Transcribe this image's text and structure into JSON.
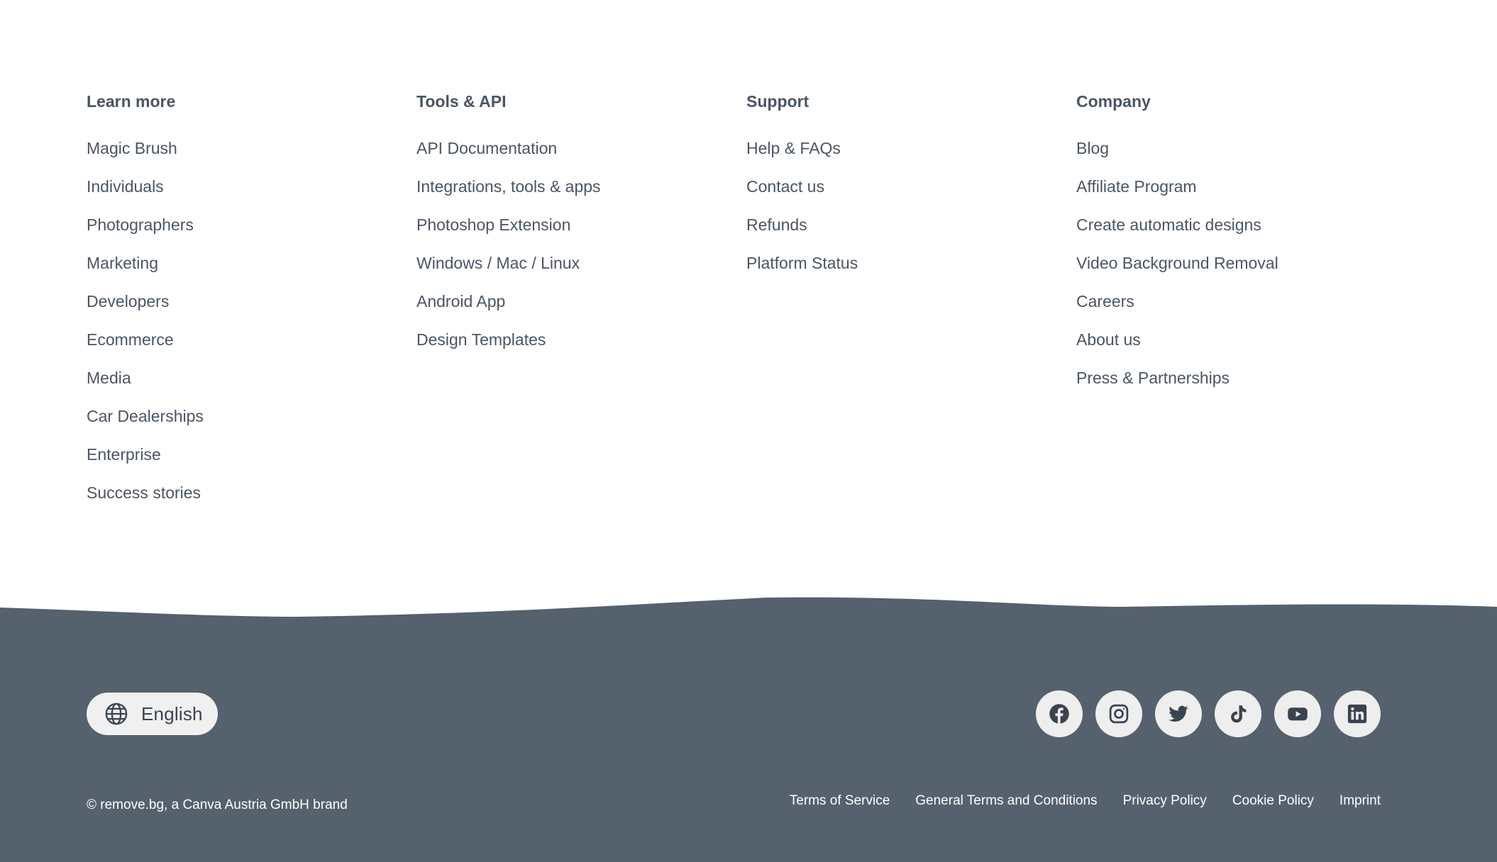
{
  "columns": [
    {
      "title": "Learn more",
      "links": [
        "Magic Brush",
        "Individuals",
        "Photographers",
        "Marketing",
        "Developers",
        "Ecommerce",
        "Media",
        "Car Dealerships",
        "Enterprise",
        "Success stories"
      ]
    },
    {
      "title": "Tools & API",
      "links": [
        "API Documentation",
        "Integrations, tools & apps",
        "Photoshop Extension",
        "Windows / Mac / Linux",
        "Android App",
        "Design Templates"
      ]
    },
    {
      "title": "Support",
      "links": [
        "Help & FAQs",
        "Contact us",
        "Refunds",
        "Platform Status"
      ]
    },
    {
      "title": "Company",
      "links": [
        "Blog",
        "Affiliate Program",
        "Create automatic designs",
        "Video Background Removal",
        "Careers",
        "About us",
        "Press & Partnerships"
      ]
    }
  ],
  "language": {
    "label": "English",
    "icon": "globe-icon"
  },
  "socials": [
    {
      "name": "facebook",
      "icon": "facebook-icon"
    },
    {
      "name": "instagram",
      "icon": "instagram-icon"
    },
    {
      "name": "twitter",
      "icon": "twitter-icon"
    },
    {
      "name": "tiktok",
      "icon": "tiktok-icon"
    },
    {
      "name": "youtube",
      "icon": "youtube-icon"
    },
    {
      "name": "linkedin",
      "icon": "linkedin-icon"
    }
  ],
  "copyright": "© remove.bg, a Canva Austria GmbH brand",
  "legal_links": [
    "Terms of Service",
    "General Terms and Conditions",
    "Privacy Policy",
    "Cookie Policy",
    "Imprint"
  ],
  "colors": {
    "footer_background": "#55616d",
    "link_text": "#4b5563",
    "pill_background": "#f0f0f0",
    "icon_color": "#3a4350"
  }
}
